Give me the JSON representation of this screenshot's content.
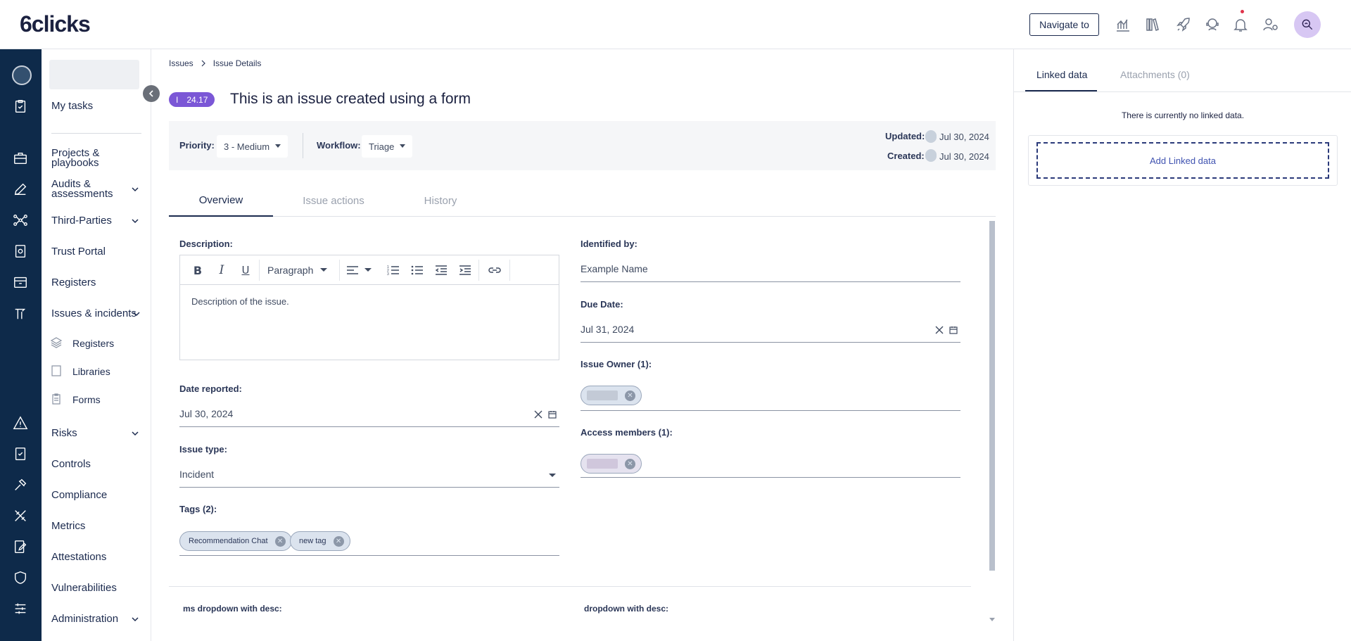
{
  "app": {
    "logo": "6clicks"
  },
  "topbar": {
    "navigate_label": "Navigate to",
    "icons": [
      "analytics-icon",
      "library-icon",
      "rocket-icon",
      "support-icon",
      "bell-icon",
      "user-settings-icon",
      "profile-icon"
    ]
  },
  "sidebar": {
    "items": [
      {
        "label": "My tasks"
      },
      {
        "label": "Projects &\nplaybooks"
      },
      {
        "label": "Audits &\nassessments"
      },
      {
        "label": "Third-Parties"
      },
      {
        "label": "Trust Portal"
      },
      {
        "label": "Registers"
      },
      {
        "label": "Issues & incidents"
      },
      {
        "label": "Risks"
      },
      {
        "label": "Controls"
      },
      {
        "label": "Compliance"
      },
      {
        "label": "Metrics"
      },
      {
        "label": "Attestations"
      },
      {
        "label": "Vulnerabilities"
      },
      {
        "label": "Administration"
      }
    ],
    "subitems": [
      {
        "label": "Registers"
      },
      {
        "label": "Libraries"
      },
      {
        "label": "Forms"
      }
    ]
  },
  "breadcrumb": {
    "root": "Issues",
    "current": "Issue Details"
  },
  "issue": {
    "badge_letter": "I",
    "badge_number": "24.17",
    "title": "This is an issue created using a form"
  },
  "meta": {
    "priority_label": "Priority:",
    "priority_value": "3 - Medium",
    "workflow_label": "Workflow:",
    "workflow_value": "Triage",
    "updated_label": "Updated:",
    "updated_value": "Jul 30, 2024",
    "created_label": "Created:",
    "created_value": "Jul 30, 2024"
  },
  "tabs": [
    {
      "label": "Overview",
      "active": true
    },
    {
      "label": "Issue actions",
      "active": false
    },
    {
      "label": "History",
      "active": false
    }
  ],
  "form": {
    "description_label": "Description:",
    "editor_paragraph": "Paragraph",
    "description_text": "Description of the issue.",
    "date_reported_label": "Date reported:",
    "date_reported_value": "Jul 30, 2024",
    "issue_type_label": "Issue type:",
    "issue_type_value": "Incident",
    "tags_label": "Tags (2):",
    "tags": [
      "Recommendation Chat",
      "new tag"
    ],
    "identified_by_label": "Identified by:",
    "identified_by_value": "Example Name",
    "due_date_label": "Due Date:",
    "due_date_value": "Jul 31, 2024",
    "issue_owner_label": "Issue Owner (1):",
    "access_members_label": "Access members (1):",
    "ms_dropdown_label": "ms dropdown with desc:",
    "dropdown_label": "dropdown with desc:"
  },
  "right_panel": {
    "tab_linked": "Linked data",
    "tab_attachments": "Attachments (0)",
    "empty_text": "There is currently no linked data.",
    "add_label": "Add Linked data"
  }
}
